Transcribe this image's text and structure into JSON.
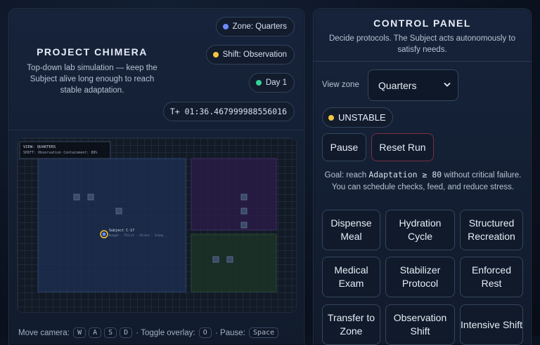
{
  "left": {
    "title": "PROJECT CHIMERA",
    "subtitle": "Top-down lab simulation — keep the Subject alive long enough to reach stable adaptation.",
    "chips": {
      "zone": "Zone: Quarters",
      "shift": "Shift: Observation",
      "day": "Day 1",
      "timer": "T+ 01:36.467999988556016"
    },
    "map": {
      "overlay_line1": "VIEW: QUARTERS",
      "overlay_line2": "SHIFT: Observation  Containment: 88%",
      "subject_label": "Subject C-17",
      "subject_sublabel": "Hunger · Thirst · Stress · Sleep"
    },
    "hint": {
      "move_label": "Move camera:",
      "keys_move": [
        "W",
        "A",
        "S",
        "D"
      ],
      "overlay_label": "· Toggle overlay:",
      "key_overlay": "O",
      "pause_label": "· Pause:",
      "key_pause": "Space"
    }
  },
  "right": {
    "title": "CONTROL PANEL",
    "subtitle": "Decide protocols. The Subject acts autonomously to satisfy needs.",
    "view_zone_label": "View zone",
    "view_zone_value": "Quarters",
    "status": "UNSTABLE",
    "pause_label": "Pause",
    "reset_label": "Reset Run",
    "goal_prefix": "Goal: reach",
    "goal_metric": "Adaptation ≥ 80",
    "goal_suffix": "without critical failure. You can schedule checks, feed, and reduce stress.",
    "actions": [
      {
        "label": "Dispense Meal"
      },
      {
        "label": "Hydration Cycle"
      },
      {
        "label": "Structured Recreation"
      },
      {
        "label": "Medical Exam"
      },
      {
        "label": "Stabilizer Protocol"
      },
      {
        "label": "Enforced Rest"
      },
      {
        "label": "Transfer to Zone"
      },
      {
        "label": "Observation Shift"
      },
      {
        "label": "Intensive Shift"
      }
    ]
  },
  "colors": {
    "zone_dot": "#6d8cff",
    "shift_dot": "#f4c542",
    "day_dot": "#34d399",
    "status_dot": "#f4c542",
    "room_quarters": "#1c2f52",
    "room_purple": "#2a1c47",
    "room_green": "#1b3326",
    "subject": "#f4c542"
  },
  "icons": {
    "select_caret": "chevron-down-icon"
  }
}
